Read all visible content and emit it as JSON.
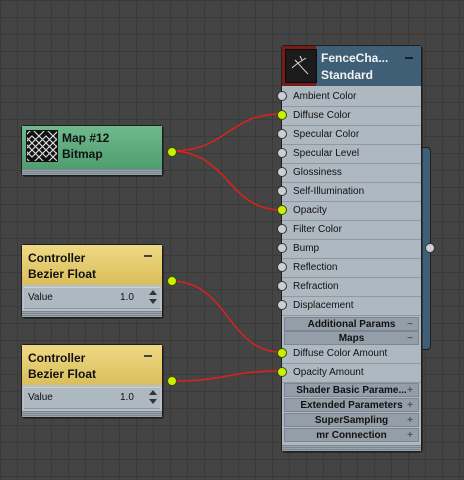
{
  "bitmap_node": {
    "title": "Map #12",
    "subtitle": "Bitmap"
  },
  "controller_1": {
    "title": "Controller",
    "subtitle": "Bezier Float",
    "row_label": "Value",
    "row_value": "1.0"
  },
  "controller_2": {
    "title": "Controller",
    "subtitle": "Bezier Float",
    "row_label": "Value",
    "row_value": "1.0"
  },
  "material_node": {
    "title": "FenceCha...",
    "subtitle": "Standard",
    "slots": [
      "Ambient Color",
      "Diffuse Color",
      "Specular Color",
      "Specular Level",
      "Glossiness",
      "Self-Illumination",
      "Opacity",
      "Filter Color",
      "Bump",
      "Reflection",
      "Refraction",
      "Displacement"
    ],
    "rollouts": {
      "additional_params": "Additional Params",
      "maps": "Maps",
      "shader_basic": "Shader Basic Parame...",
      "extended": "Extended Parameters",
      "supersampling": "SuperSampling",
      "mr_connection": "mr Connection"
    },
    "map_slots": [
      "Diffuse Color Amount",
      "Opacity Amount"
    ]
  },
  "colors": {
    "wire": "#e0201a",
    "port_live": "#c8f000",
    "material_header": "#3f5f77",
    "bitmap_header": "#5aa97c",
    "controller_header": "#e6cd70"
  }
}
